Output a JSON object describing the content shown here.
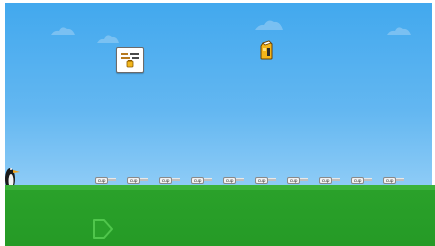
{
  "scene": {
    "colors": {
      "sky_top": "#41a8ee",
      "sky_bottom": "#9fd3f7",
      "grass": "#259a26",
      "grass_edge": "#3bb23a"
    },
    "cup_label": "cup",
    "cup_count": 10,
    "icons": {
      "player": "penguin-icon",
      "sign": "signboard-icon",
      "jar": "honey-jar-icon",
      "arrow": "play-arrow-icon"
    }
  }
}
